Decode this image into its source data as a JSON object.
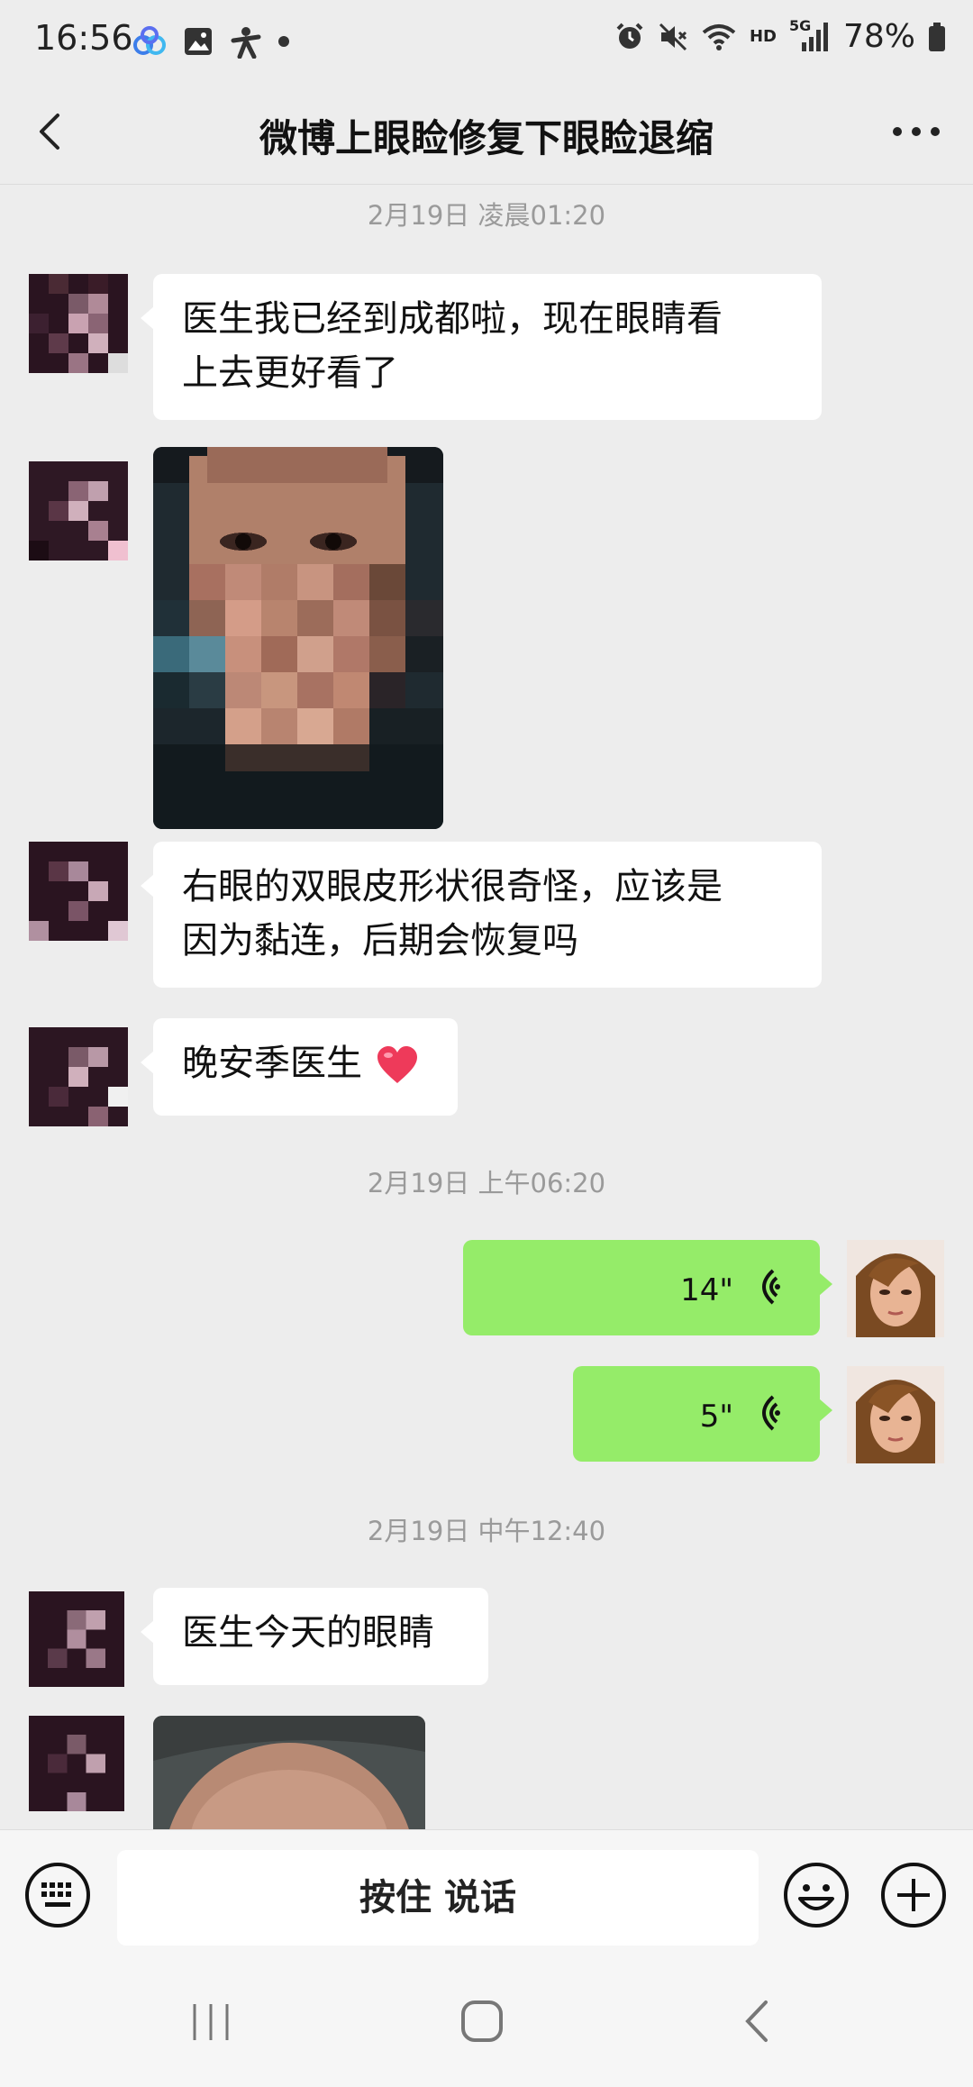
{
  "status_bar": {
    "time": "16:56",
    "battery": "78%",
    "network": "HD",
    "signal": "5G",
    "left_icons": [
      "baidu-cloud-icon",
      "gallery-icon",
      "app-icon",
      "dot-icon"
    ],
    "right_icons": [
      "alarm-icon",
      "mute-icon",
      "wifi-icon",
      "signal-icon",
      "battery-icon"
    ]
  },
  "header": {
    "title": "微博上眼睑修复下眼睑退缩",
    "back_icon": "chevron-left-icon",
    "more_icon": "more-horizontal-icon"
  },
  "timestamps": [
    "2月19日 凌晨01:20",
    "2月19日 上午06:20",
    "2月19日 中午12:40"
  ],
  "messages": [
    {
      "type": "text",
      "dir": "in",
      "lines": [
        "医生我已经到成都啦，现在眼睛看",
        "上去更好看了"
      ]
    },
    {
      "type": "image",
      "dir": "in",
      "content": "pixelated face photo"
    },
    {
      "type": "text",
      "dir": "in",
      "lines": [
        "右眼的双眼皮形状很奇怪，应该是",
        "因为黏连，后期会恢复吗"
      ]
    },
    {
      "type": "text",
      "dir": "in",
      "lines": [
        "晚安季医生"
      ],
      "emoji": "heart"
    },
    {
      "type": "voice",
      "dir": "out",
      "duration": "14\""
    },
    {
      "type": "voice",
      "dir": "out",
      "duration": "5\""
    },
    {
      "type": "text",
      "dir": "in",
      "lines": [
        "医生今天的眼睛"
      ]
    },
    {
      "type": "image",
      "dir": "in",
      "content": "partial forehead photo"
    }
  ],
  "input_bar": {
    "hold_to_talk": "按住 说话",
    "keyboard_icon": "keyboard-icon",
    "emoji_icon": "emoji-icon",
    "plus_icon": "plus-circle-icon"
  },
  "nav_bar": {
    "icons": [
      "recent-apps-icon",
      "home-icon",
      "back-icon"
    ]
  },
  "colors": {
    "background": "#ededed",
    "bubble_in": "#ffffff",
    "bubble_out": "#95ec69",
    "timestamp_text": "#9a9a9a"
  }
}
